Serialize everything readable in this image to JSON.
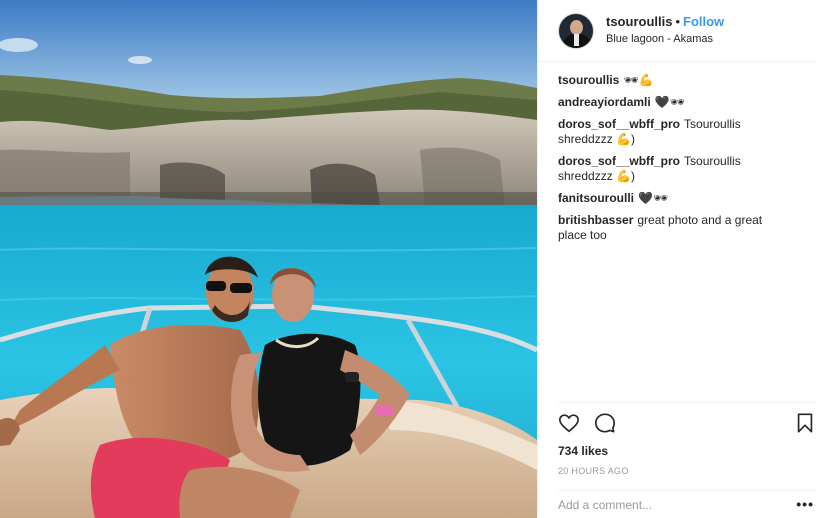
{
  "post": {
    "header": {
      "username": "tsouroullis",
      "separator": "•",
      "follow_label": "Follow",
      "location": "Blue lagoon - Akamas"
    },
    "photo": {
      "description_icon": "post-photo"
    },
    "comments": [
      {
        "user": "tsouroullis",
        "text": "🕶💪"
      },
      {
        "user": "andreayiordamli",
        "text": "🖤🕶"
      },
      {
        "user": "doros_sof__wbff_pro",
        "text": "Tsouroullis shreddzzz 💪)"
      },
      {
        "user": "doros_sof__wbff_pro",
        "text": "Tsouroullis shreddzzz 💪)"
      },
      {
        "user": "fanitsouroulli",
        "text": "🖤🕶"
      },
      {
        "user": "britishbasser",
        "text": "great photo and a great place too"
      }
    ],
    "likes": "734 likes",
    "timestamp": "20 HOURS AGO",
    "comment_input": {
      "placeholder": "Add a comment...",
      "more_label": "•••"
    }
  },
  "colors": {
    "accent": "#3897f0",
    "sea": "#1fb3d8",
    "sky": "#4f8fd4"
  }
}
